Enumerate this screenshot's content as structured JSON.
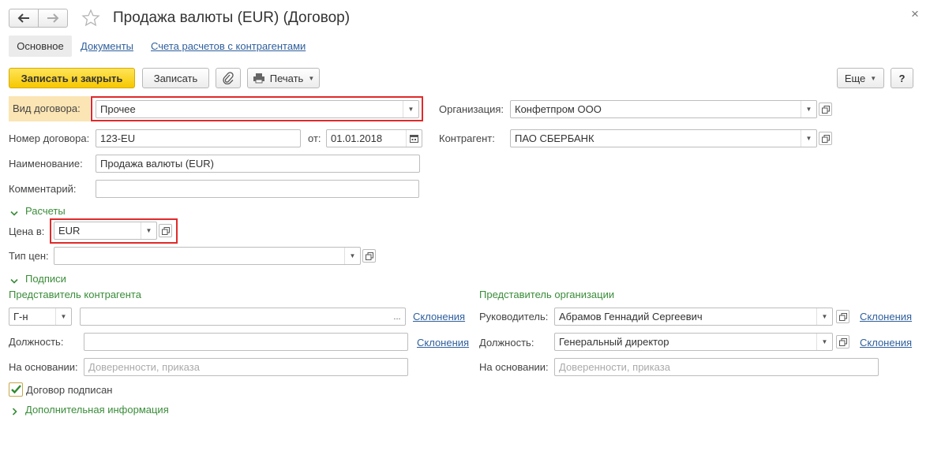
{
  "window": {
    "title": "Продажа валюты (EUR) (Договор)",
    "back_icon": "arrow-left-icon",
    "forward_icon": "arrow-right-icon",
    "favorite_icon": "star-icon",
    "close_glyph": "×"
  },
  "tabs": [
    {
      "label": "Основное",
      "active": true
    },
    {
      "label": "Документы",
      "active": false
    },
    {
      "label": "Счета расчетов с контрагентами",
      "active": false
    }
  ],
  "toolbar": {
    "save_close_label": "Записать и закрыть",
    "save_label": "Записать",
    "attach_icon": "paperclip-icon",
    "print_label": "Печать",
    "more_label": "Еще",
    "help_label": "?"
  },
  "form": {
    "contract_type": {
      "label": "Вид договора:",
      "value": "Прочее"
    },
    "organization": {
      "label": "Организация:",
      "value": "Конфетпром ООО"
    },
    "contract_number": {
      "label": "Номер договора:",
      "value": "123-EU"
    },
    "date": {
      "label": "от:",
      "value": "01.01.2018"
    },
    "counterparty": {
      "label": "Контрагент:",
      "value": "ПАО СБЕРБАНК"
    },
    "name": {
      "label": "Наименование:",
      "value": "Продажа валюты (EUR)"
    },
    "comment": {
      "label": "Комментарий:",
      "value": ""
    }
  },
  "settlements": {
    "title": "Расчеты",
    "price_in": {
      "label": "Цена в:",
      "value": "EUR"
    },
    "price_type": {
      "label": "Тип цен:",
      "value": ""
    }
  },
  "signatures": {
    "title": "Подписи",
    "counterparty_rep": {
      "title": "Представитель контрагента",
      "salutation": "Г-н",
      "name_value": "",
      "declensions": "Склонения",
      "position_label": "Должность:",
      "position_value": "",
      "position_declensions": "Склонения",
      "basis_label": "На основании:",
      "basis_placeholder": "Доверенности, приказа"
    },
    "organization_rep": {
      "title": "Представитель организации",
      "head_label": "Руководитель:",
      "head_value": "Абрамов Геннадий Сергеевич",
      "declensions": "Склонения",
      "position_label": "Должность:",
      "position_value": "Генеральный директор",
      "position_declensions": "Склонения",
      "basis_label": "На основании:",
      "basis_placeholder": "Доверенности, приказа"
    }
  },
  "signed": {
    "label": "Договор подписан",
    "checked": true
  },
  "additional": {
    "title": "Дополнительная информация"
  },
  "colors": {
    "accent_green": "#3a8c3a",
    "link_blue": "#2f5f9c",
    "highlight_red": "#e02a2a",
    "primary_yellow": "#f6c800"
  }
}
